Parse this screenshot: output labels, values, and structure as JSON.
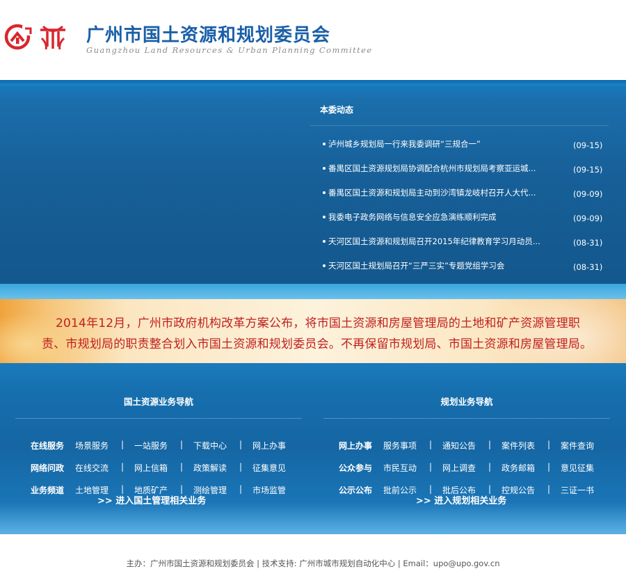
{
  "header": {
    "title": "广州市国土资源和规划委员会",
    "subtitle": "Guangzhou Land Resources & Urban Planning Committee",
    "logo_icon": "gz-land-planning-logo",
    "colors": {
      "brand_blue": "#1a5fa8",
      "logo_red": "#d9262e"
    }
  },
  "news": {
    "heading": "本委动态",
    "items": [
      {
        "title": "泸州城乡规划局一行来我委调研“三规合一”",
        "date": "(09-15)"
      },
      {
        "title": "番禺区国土资源规划局协调配合杭州市规划局考察亚运城...",
        "date": "(09-15)"
      },
      {
        "title": "番禺区国土资源和规划局主动到沙湾镇龙岐村召开人大代...",
        "date": "(09-09)"
      },
      {
        "title": "我委电子政务网络与信息安全应急演练顺利完成",
        "date": "(09-09)"
      },
      {
        "title": "天河区国土资源和规划局召开2015年纪律教育学习月动员...",
        "date": "(08-31)"
      },
      {
        "title": "天河区国土规划局召开“三严三实”专题党组学习会",
        "date": "(08-31)"
      }
    ]
  },
  "notice": {
    "line1": "2014年12月，广州市政府机构改革方案公布，将市国土资源和房屋管理局的土地和矿产资源管理职",
    "line2": "责、市规划局的职责整合划入市国土资源和规划委员会。不再保留市规划局、市国土资源和房屋管理局。",
    "color": "#c0201e"
  },
  "nav": {
    "land": {
      "title": "国土资源业务导航",
      "rows": [
        {
          "category": "在线服务",
          "links": [
            "场景服务",
            "一站服务",
            "下载中心",
            "网上办事"
          ]
        },
        {
          "category": "网络问政",
          "links": [
            "在线交流",
            "网上信箱",
            "政策解读",
            "征集意见"
          ]
        },
        {
          "category": "业务频道",
          "links": [
            "土地管理",
            "地质矿产",
            "测绘管理",
            "市场监管"
          ]
        }
      ],
      "enter": ">>  进入国土管理相关业务"
    },
    "plan": {
      "title": "规划业务导航",
      "rows": [
        {
          "category": "网上办事",
          "links": [
            "服务事项",
            "通知公告",
            "案件列表",
            "案件查询"
          ]
        },
        {
          "category": "公众参与",
          "links": [
            "市民互动",
            "网上调查",
            "政务邮箱",
            "意见征集"
          ]
        },
        {
          "category": "公示公布",
          "links": [
            "批前公示",
            "批后公布",
            "控规公告",
            "三证一书"
          ]
        }
      ],
      "enter": ">>  进入规划相关业务"
    },
    "separator": "|"
  },
  "footer": {
    "text": "主办：广州市国土资源和规划委员会    |  技术支持: 广州市城市规划自动化中心  |  Email：upo@upo.gov.cn"
  }
}
